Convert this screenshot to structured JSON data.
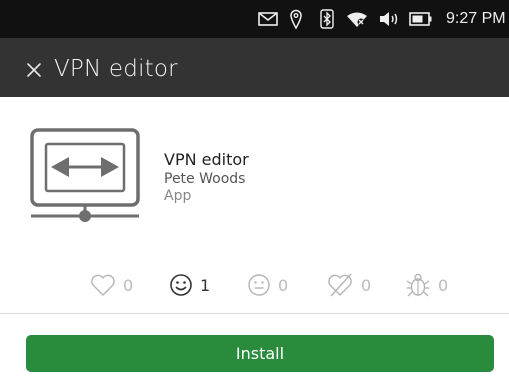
{
  "status_bar": {
    "time": "9:27 PM",
    "icons": [
      "messages-icon",
      "location-icon",
      "bluetooth-icon",
      "wifi-icon",
      "volume-icon",
      "battery-icon"
    ]
  },
  "header": {
    "title": "VPN editor",
    "close_icon": "close-icon"
  },
  "app": {
    "name": "VPN editor",
    "author": "Pete Woods",
    "type": "App",
    "icon": "vpn-editor-icon"
  },
  "ratings": [
    {
      "icon": "heart-icon",
      "count": "0"
    },
    {
      "icon": "happy-face-icon",
      "count": "1"
    },
    {
      "icon": "neutral-face-icon",
      "count": "0"
    },
    {
      "icon": "broken-heart-icon",
      "count": "0"
    },
    {
      "icon": "bug-icon",
      "count": "0"
    }
  ],
  "install": {
    "label": "Install"
  },
  "colors": {
    "status_bar_bg": "#111111",
    "header_bg": "#333333",
    "install_button": "#2a8b3d"
  }
}
